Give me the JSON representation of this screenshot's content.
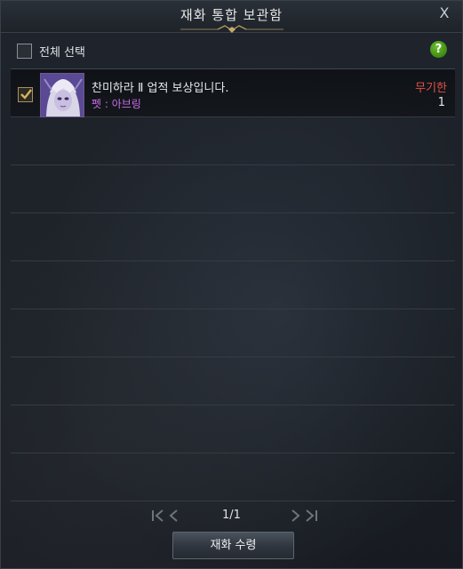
{
  "window": {
    "title": "재화 통합 보관함",
    "close_symbol": "X"
  },
  "select_all": {
    "label": "전체 선택",
    "checked": false
  },
  "help": {
    "symbol": "?"
  },
  "items": [
    {
      "name": "찬미하라 Ⅱ 업적 보상입니다.",
      "subtitle": "펫 : 아브링",
      "expiry": "무기한",
      "quantity": "1",
      "checked": true
    }
  ],
  "pagination": {
    "text": "1/1"
  },
  "claim_button": {
    "label": "재화 수령"
  },
  "colors": {
    "expiry": "#e0524a",
    "pet_name": "#c86ee8",
    "check": "#d9b35a"
  }
}
